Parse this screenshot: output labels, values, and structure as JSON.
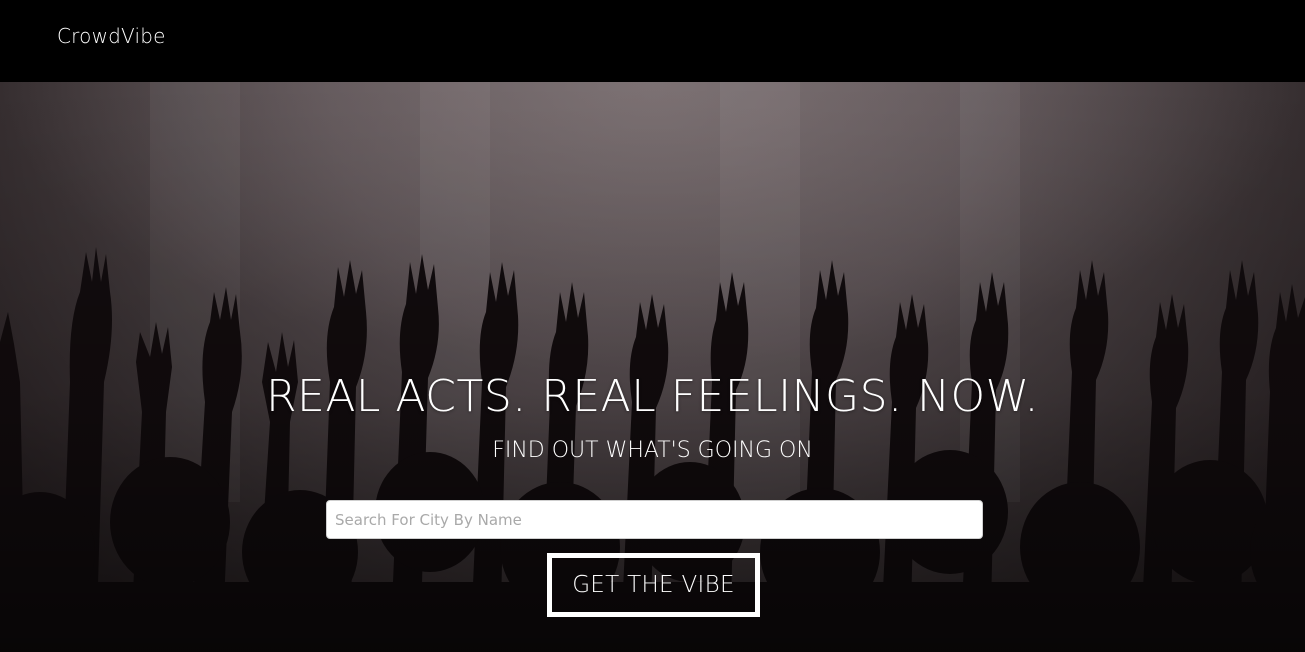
{
  "navbar": {
    "brand": "CrowdVibe"
  },
  "hero": {
    "title": "REAL ACTS. REAL FEELINGS. NOW.",
    "subtitle": "FIND OUT WHAT'S GOING ON",
    "background": "concert-crowd-raised-hands-photo",
    "search": {
      "placeholder": "Search For City By Name",
      "value": ""
    },
    "button_label": "GET THE VIBE"
  },
  "colors": {
    "navbar_bg": "#000000",
    "text": "#ffffff",
    "hero_haze": "#6f6466",
    "hero_shadow": "#1c1517"
  }
}
